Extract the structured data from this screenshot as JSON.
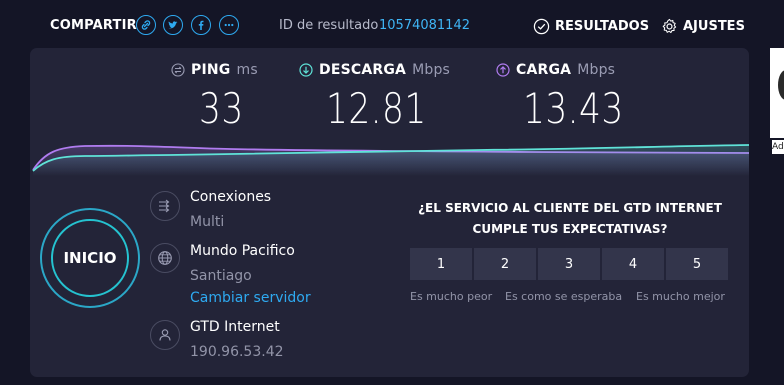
{
  "topbar": {
    "share_label": "COMPARTIR",
    "share_icons": [
      "link-icon",
      "twitter-icon",
      "facebook-icon",
      "more-icon"
    ],
    "result_id_label": "ID de resultado",
    "result_id_value": "10574081142",
    "results_label": "RESULTADOS",
    "settings_label": "AJUSTES"
  },
  "metrics": {
    "ping": {
      "label": "PING",
      "unit": "ms",
      "value": "33",
      "icon": "ping-icon"
    },
    "download": {
      "label": "DESCARGA",
      "unit": "Mbps",
      "value": "12.81",
      "icon": "download-icon",
      "color": "#5fe3d8"
    },
    "upload": {
      "label": "CARGA",
      "unit": "Mbps",
      "value": "13.43",
      "icon": "upload-icon",
      "color": "#b07cf0"
    }
  },
  "start_button": {
    "label": "INICIO"
  },
  "server_info": {
    "connections_title": "Conexiones",
    "connections_value": "Multi",
    "server_name": "Mundo Pacifico",
    "server_location": "Santiago",
    "change_server": "Cambiar servidor",
    "isp_name": "GTD Internet",
    "ip_address": "190.96.53.42"
  },
  "survey": {
    "question_line1": "¿EL SERVICIO AL CLIENTE DEL GTD INTERNET",
    "question_line2": "CUMPLE TUS EXPECTATIVAS?",
    "ratings": [
      "1",
      "2",
      "3",
      "4",
      "5"
    ],
    "label_low": "Es mucho peor",
    "label_mid": "Es como se esperaba",
    "label_high": "Es mucho mejor"
  },
  "colors": {
    "background": "#141526",
    "panel": "#232438",
    "accent": "#2ea9f0",
    "download": "#5fe3d8",
    "upload": "#b07cf0"
  },
  "edge": {
    "partial_text": "Ad"
  }
}
